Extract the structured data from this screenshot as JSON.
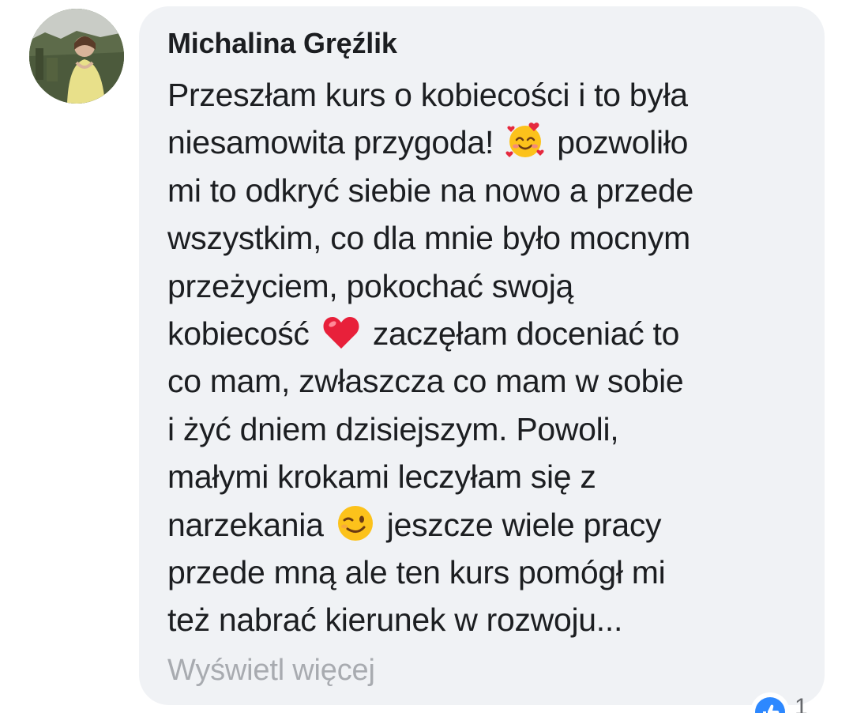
{
  "comment": {
    "author": "Michalina Gręźlik",
    "lines": [
      {
        "before": "Przeszłam kurs o kobiecości i to była"
      },
      {
        "before": "niesamowita przygoda!",
        "emoji": "smiling-face-with-hearts-icon",
        "after": "pozwoliło"
      },
      {
        "before": "mi to odkryć siebie na nowo a przede"
      },
      {
        "before": "wszystkim, co dla mnie było mocnym"
      },
      {
        "before": "przeżyciem, pokochać swoją"
      },
      {
        "before": "kobiecość",
        "emoji": "red-heart-icon",
        "after": "zaczęłam doceniać to"
      },
      {
        "before": "co mam, zwłaszcza co mam w sobie"
      },
      {
        "before": "i żyć dniem dzisiejszym. Powoli,"
      },
      {
        "before": "małymi krokami leczyłam się z"
      },
      {
        "before": "narzekania",
        "emoji": "winking-face-icon",
        "after": "jeszcze wiele pracy"
      },
      {
        "before": "przede mną ale ten kurs pomógł mi"
      },
      {
        "before": "też nabrać kierunek w rozwoju..."
      }
    ],
    "see_more": "Wyświetl więcej",
    "reaction": {
      "icon": "like-icon",
      "count": "1"
    }
  },
  "colors": {
    "bubble": "#f0f2f5",
    "text": "#1c1e21",
    "see_more": "#a8abb0",
    "like": "#2d88ff"
  }
}
